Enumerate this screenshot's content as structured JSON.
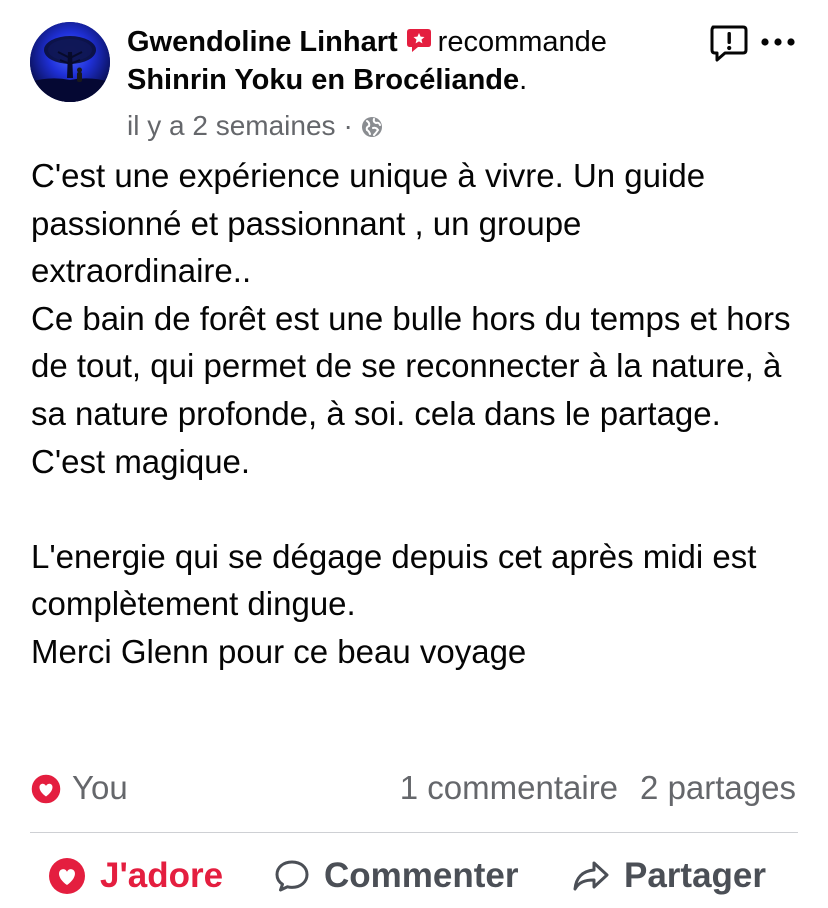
{
  "post": {
    "author": "Gwendoline Linhart",
    "action_text": "recommande",
    "page_name": "Shinrin Yoku en Brocéliande",
    "period": ".",
    "timestamp": "il y a 2 semaines",
    "separator": "·",
    "body": {
      "p1": "C'est une expérience unique à vivre. Un guide passionné et passionnant , un groupe extraordinaire..",
      "p2": "Ce bain de forêt est une bulle hors du temps et hors de tout, qui permet de se reconnecter à la nature, à sa nature profonde, à soi. cela dans le partage. C'est magique.",
      "p3": "L'energie qui se dégage depuis cet après midi est complètement dingue.",
      "p4": "Merci Glenn pour ce beau voyage"
    }
  },
  "reactions": {
    "icon": "love-reaction-icon",
    "name": "You",
    "comments": "1 commentaire",
    "shares": "2 partages"
  },
  "actions": {
    "love": "J'adore",
    "comment": "Commenter",
    "share": "Partager"
  },
  "colors": {
    "love_red": "#e41e3f",
    "recommend_red": "#e41e3f",
    "secondary_text": "#65676b",
    "action_text": "#4b4f56"
  }
}
